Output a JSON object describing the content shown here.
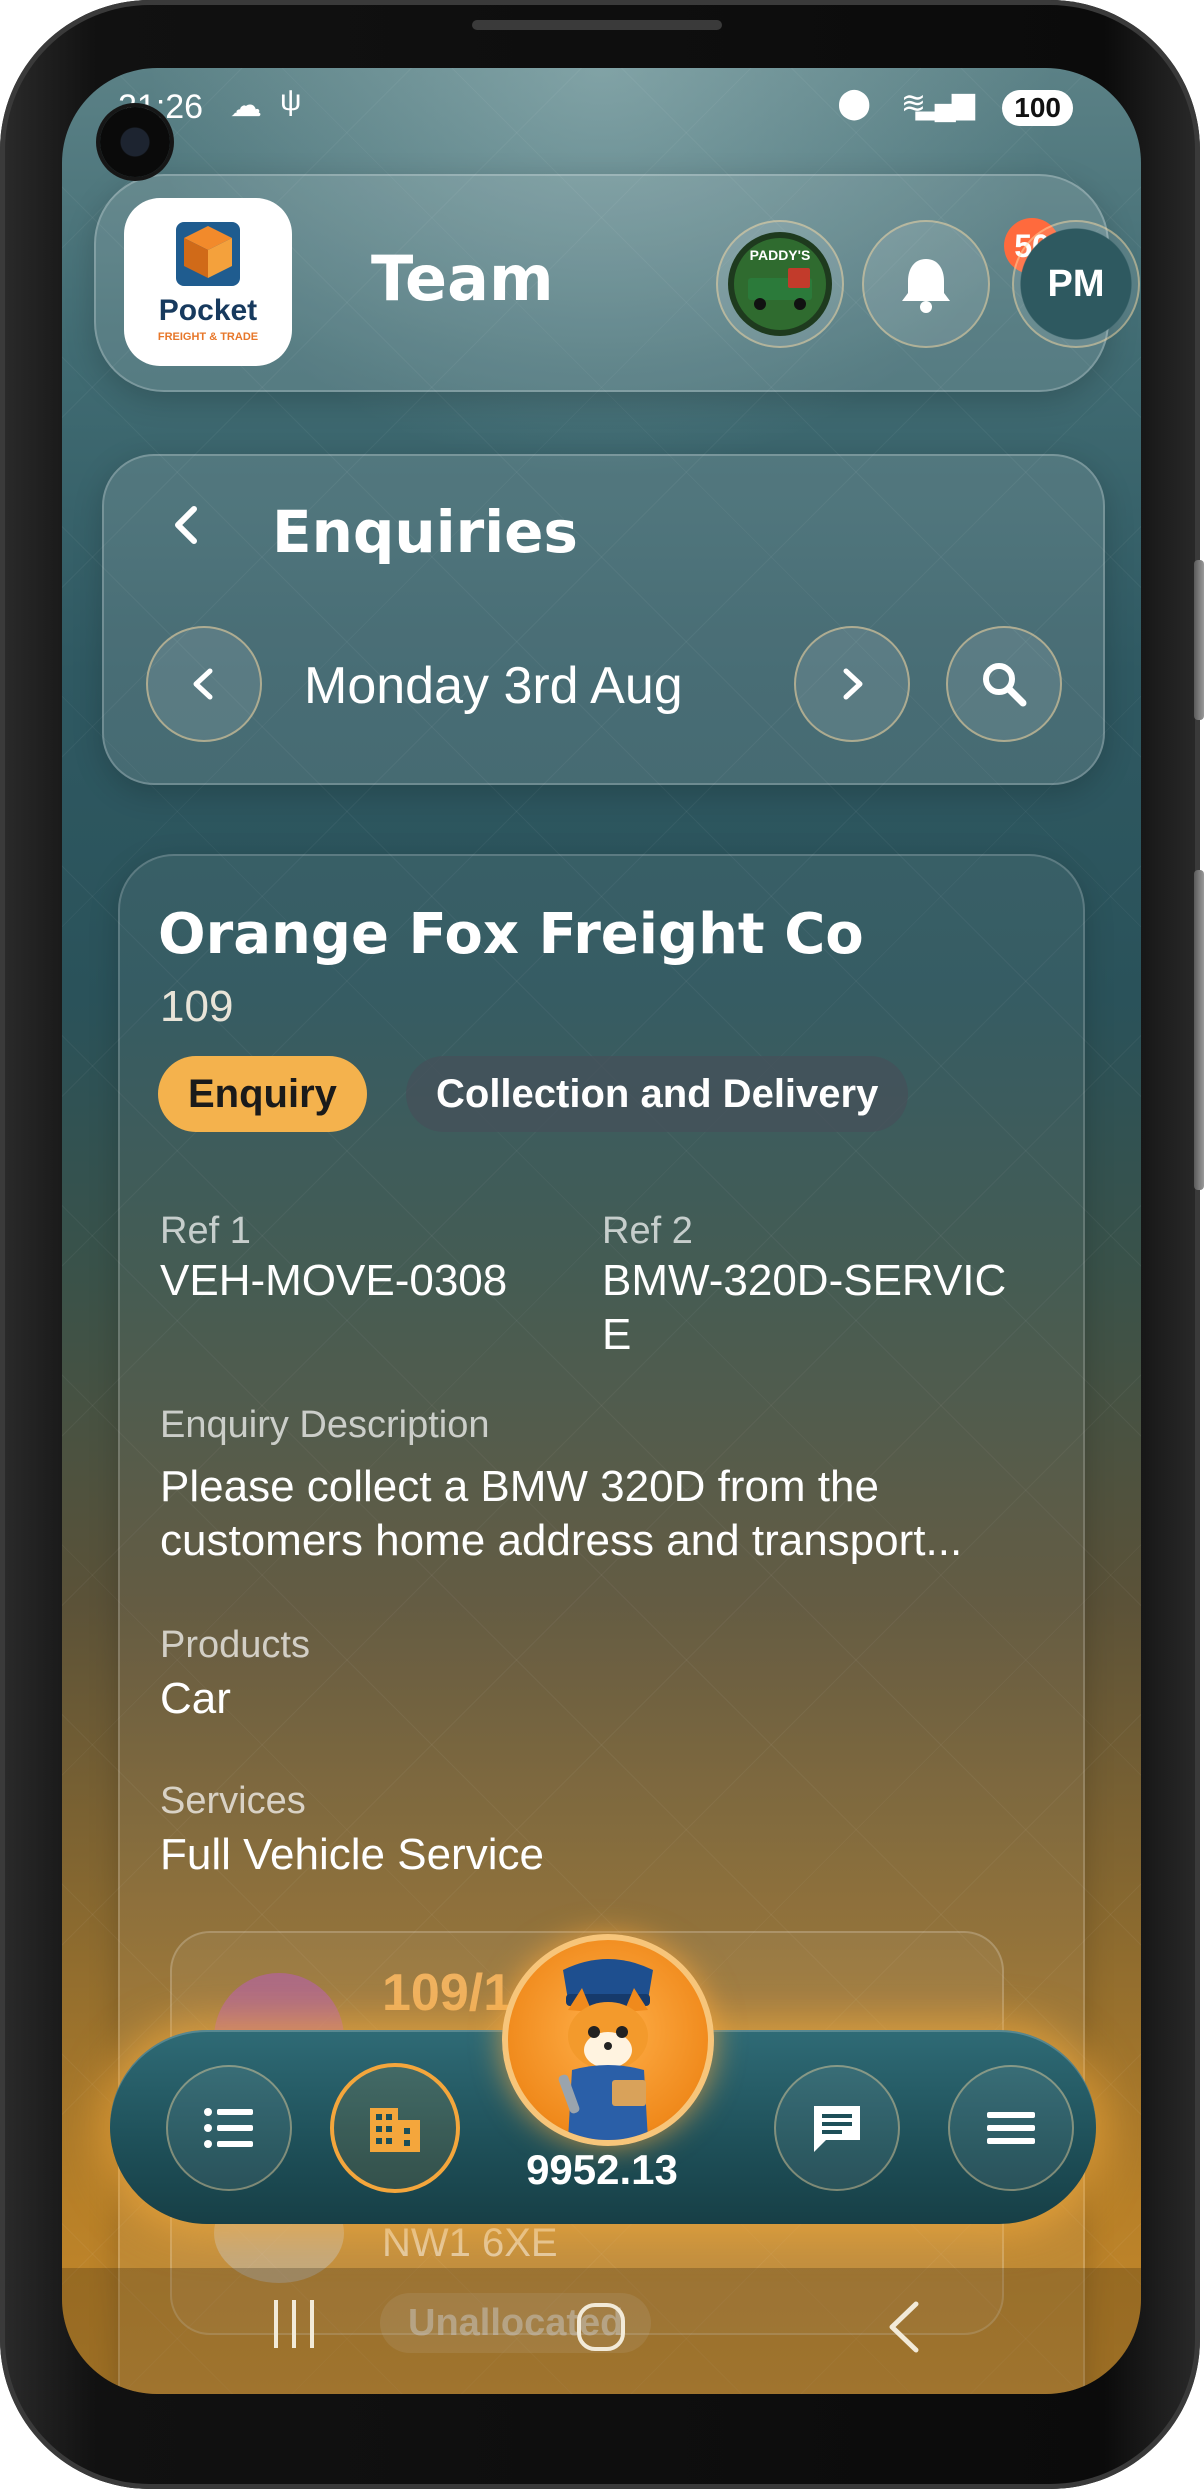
{
  "status_bar": {
    "time": "21:26",
    "battery": "100"
  },
  "header": {
    "title": "Team",
    "notification_count": "50",
    "avatar_initials": "PM",
    "logo_text": "Pocket",
    "logo_subtext": "FREIGHT & TRADE",
    "company_badge_text": "PADDY'S"
  },
  "enquiries": {
    "title": "Enquiries",
    "date": "Monday 3rd Aug"
  },
  "card": {
    "company": "Orange Fox Freight Co",
    "job_number": "109",
    "status_pill": "Enquiry",
    "type_pill": "Collection and Delivery",
    "ref1_label": "Ref 1",
    "ref1_value": "VEH-MOVE-0308",
    "ref2_label": "Ref 2",
    "ref2_value": "BMW-320D-SERVIC\nE",
    "description_label": "Enquiry Description",
    "description_value": "Please collect a BMW 320D from the customers home address and transport...",
    "products_label": "Products",
    "products_value": "Car",
    "services_label": "Services",
    "services_value": "Full Vehicle Service",
    "inner_number": "109/1",
    "inner_postcode": "NW1 6XE",
    "inner_status": "Unallocated"
  },
  "dock": {
    "balance": "9952.13"
  },
  "icons": {
    "back": "chevron-left-icon",
    "prev": "chevron-left-icon",
    "next": "chevron-right-icon",
    "search": "search-icon",
    "bell": "bell-icon",
    "list": "list-icon",
    "building": "building-icon",
    "chat": "chat-icon",
    "menu": "menu-icon"
  },
  "colors": {
    "accent": "#f4a63c",
    "badge": "#ff6a3d",
    "enquiry_pill": "#f4b24d"
  }
}
